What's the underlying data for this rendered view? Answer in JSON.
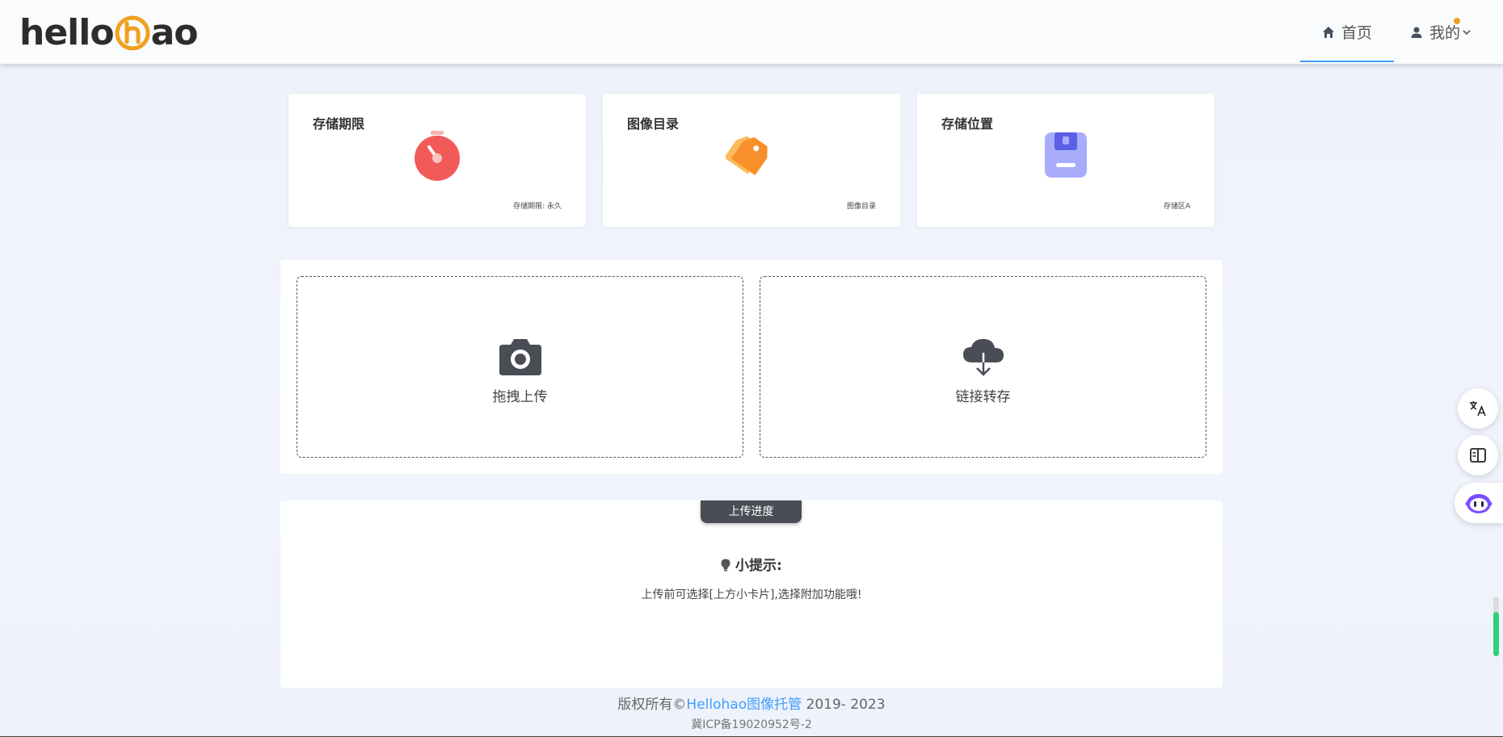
{
  "header": {
    "logo_left": "hello",
    "logo_right": "ao",
    "nav": {
      "home_label": "首页",
      "me_label": "我的"
    }
  },
  "cards": [
    {
      "title": "存储期限",
      "footer": "存储期限: 永久",
      "icon": "stopwatch-icon"
    },
    {
      "title": "图像目录",
      "footer": "图像目录",
      "icon": "tag-icon"
    },
    {
      "title": "存储位置",
      "footer": "存储区A",
      "icon": "floppy-disk-icon"
    }
  ],
  "upload": {
    "drag_label": "拖拽上传",
    "link_label": "链接转存"
  },
  "progress": {
    "tab_label": "上传进度",
    "tip_title": "小提示:",
    "tip_text": "上传前可选择[上方小卡片],选择附加功能哦!"
  },
  "footer": {
    "copyright_prefix": "版权所有©",
    "site_link": "Hellohao图像托管",
    "years": " 2019- 2023",
    "icp": "冀ICP备19020952号-2"
  },
  "side_buttons": [
    "translate-icon",
    "reader-icon",
    "chatbot-icon"
  ],
  "scroll_indicator_fraction": 0.75,
  "colors": {
    "accent": "#409eff",
    "timer": "#f25a5a",
    "tag": "#f79a2a",
    "disk": "#8c93f7",
    "progress_tab": "#4a4d55"
  }
}
